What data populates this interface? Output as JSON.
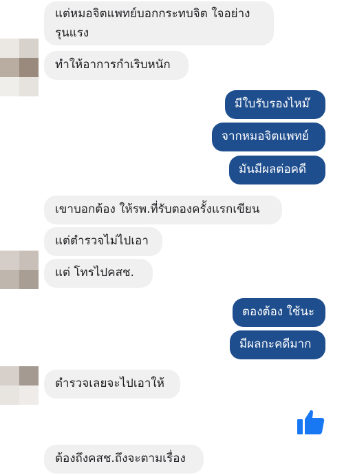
{
  "messages": {
    "m1_line1": "แต่หมอจิตแพทย์บอกกระทบจิต ใจอย่าง",
    "m1_line2": "รุนแรง",
    "m2": "ทำให้อาการกำเริบหนัก",
    "m3": "มีใบรับรองไหม๊",
    "m4": "จากหมอจิตแพทย์",
    "m5": "มันมีผลต่อคดี",
    "m6": "เขาบอกต้อง ให้รพ.ที่รับตองครั้งแรกเขียน",
    "m7": "แต่ตำรวจไม่ไปเอา",
    "m8": "แต่ โทรไปคสช.",
    "m9": "ตองต้อง ใช้นะ",
    "m10": "มีผลกะคดีมาก",
    "m11": "ตำรวจเลยจะไปเอาให้",
    "m12": "ต้องถึงคสช.ถึงจะตามเรื่อง"
  },
  "colors": {
    "incoming_bubble": "#f1f0f0",
    "outgoing_bubble": "#1f4e8e",
    "like_icon": "#1877f2"
  },
  "icons": {
    "like": "thumbs-up-icon"
  }
}
